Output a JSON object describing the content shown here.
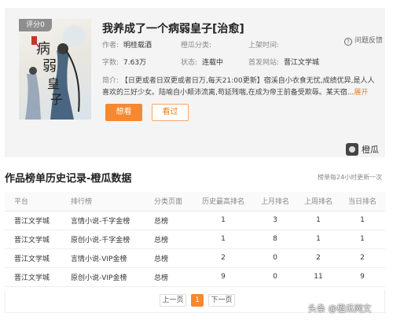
{
  "book": {
    "cover_badge": "评分0",
    "title": "我养成了一个病弱皇子[治愈]",
    "feedback_label": "问题反馈",
    "meta": {
      "author_label": "作者:",
      "author": "明桂载酒",
      "category_label": "橙瓜分类:",
      "category": "",
      "last_update_label": "上架时间:",
      "last_update": "",
      "word_count_label": "字数:",
      "word_count": "7.63万",
      "status_label": "状态:",
      "status": "连载中",
      "site_label": "首发网站:",
      "site": "晋江文学城"
    },
    "intro_label": "简介:",
    "intro_text": "【日更或者日双更或者日万,每天21:00更新】宿溪自小衣食无忧,成绩优异,是人人喜欢的三好少女。陆喻自小颠沛流离,苟延残喘,在成为帝王前备受欺辱。某天宿...",
    "intro_more": "展开",
    "read_button": "想看",
    "seen_button": "看过",
    "brand": "橙瓜"
  },
  "history": {
    "title": "作品榜单历史记录-橙瓜数据",
    "note": "榜单每24小时更新一次",
    "columns": [
      "平台",
      "排行榜",
      "分类页面",
      "历史最高排名",
      "上月排名",
      "上周排名",
      "当日排名"
    ],
    "rows": [
      [
        "晋江文学城",
        "言情小说-千字金榜",
        "总榜",
        "1",
        "3",
        "1",
        "1"
      ],
      [
        "晋江文学城",
        "原创小说-千字金榜",
        "总榜",
        "1",
        "8",
        "1",
        "1"
      ],
      [
        "晋江文学城",
        "言情小说-VIP金榜",
        "总榜",
        "2",
        "0",
        "2",
        "2"
      ],
      [
        "晋江文学城",
        "原创小说-VIP金榜",
        "总榜",
        "9",
        "0",
        "11",
        "9"
      ]
    ],
    "pager": {
      "prev": "上一页",
      "current": "1",
      "next": "下一页"
    }
  },
  "watermark": "头条 @橙瓜网文",
  "colors": {
    "accent": "#f6882f",
    "card_bg": "#f4f4f4"
  }
}
